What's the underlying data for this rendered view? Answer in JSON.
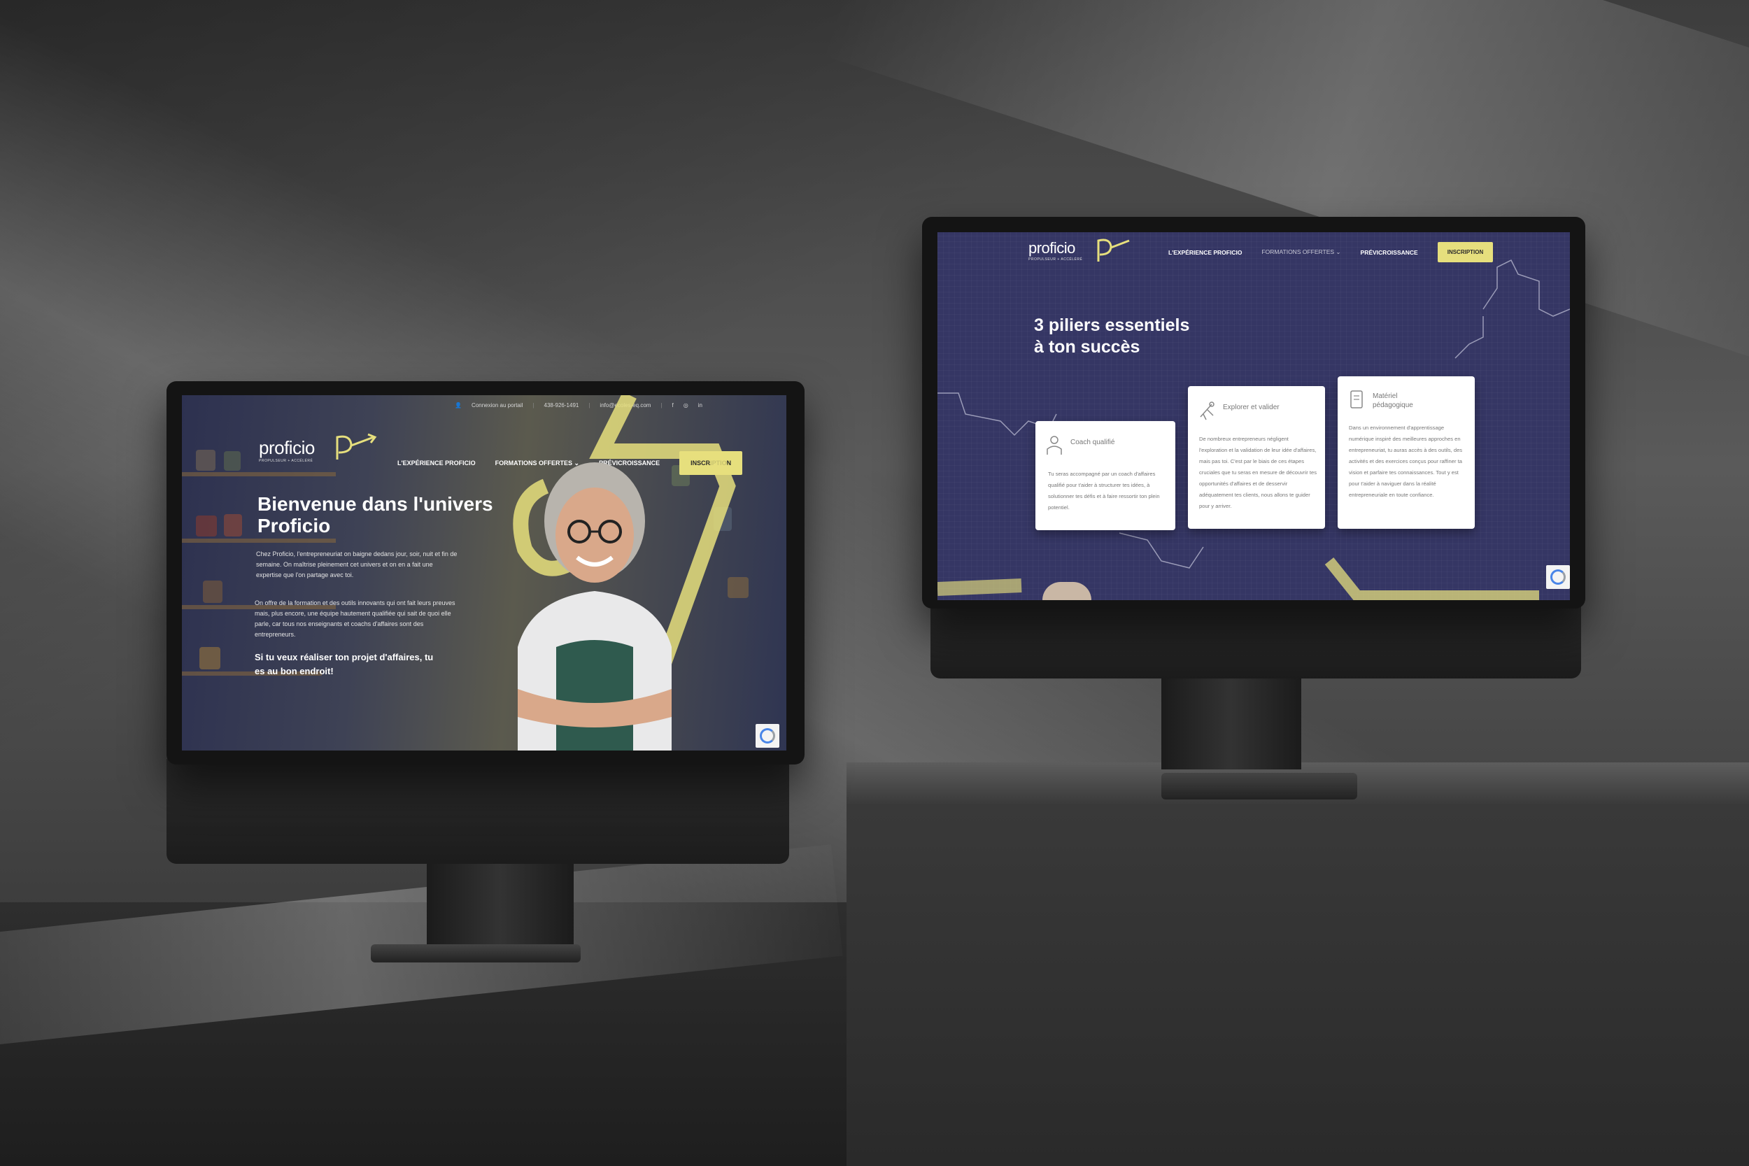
{
  "left_site": {
    "topbar": {
      "portal": "Connexion au portail",
      "phone": "438-926-1491",
      "email": "info@ecoles-eq.com",
      "social": [
        "f",
        "◎",
        "in"
      ]
    },
    "logo": {
      "word": "proficio",
      "sub": "PROPULSEUR + ACCÉLÉRÉ"
    },
    "nav": {
      "items": [
        "L'EXPÉRIENCE PROFICIO",
        "FORMATIONS OFFERTES",
        "PRÉVICROISSANCE"
      ],
      "cta": "INSCRIPTION",
      "dropdown_icon": "chevron-down-icon"
    },
    "hero": {
      "title": "Bienvenue dans l'univers Proficio",
      "p1": "Chez Proficio, l'entrepreneuriat on baigne dedans jour, soir, nuit et fin de semaine. On maîtrise pleinement cet univers et on en a fait une expertise que l'on partage avec toi.",
      "p2": "On offre de la formation et des outils innovants qui ont fait leurs preuves mais, plus encore, une équipe hautement qualifiée qui sait de quoi elle parle, car tous nos enseignants et coachs d'affaires sont des entrepreneurs.",
      "cta": "Si tu veux réaliser ton projet d'affaires, tu es au bon endroit!"
    }
  },
  "right_site": {
    "logo": {
      "word": "proficio",
      "sub": "PROPULSEUR + ACCÉLÉRÉ"
    },
    "nav": {
      "items": [
        "L'EXPÉRIENCE PROFICIO",
        "FORMATIONS OFFERTES",
        "PRÉVICROISSANCE"
      ],
      "cta": "INSCRIPTION"
    },
    "section_title_l1": "3 piliers essentiels",
    "section_title_l2": "à ton succès",
    "cards": [
      {
        "title": "Coach qualifié",
        "icon": "person-icon",
        "text": "Tu seras accompagné par un coach d'affaires qualifié pour t'aider à structurer tes idées, à solutionner tes défis et à faire ressortir ton plein potentiel."
      },
      {
        "title": "Explorer et valider",
        "icon": "telescope-icon",
        "text": "De nombreux entrepreneurs négligent l'exploration et la validation de leur idée d'affaires, mais pas toi. C'est par le biais de ces étapes cruciales que tu seras en mesure de découvrir tes opportunités d'affaires et de desservir adéquatement tes clients, nous allons te guider pour y arriver."
      },
      {
        "title": "Matériel pédagogique",
        "icon": "tablet-icon",
        "text": "Dans un environnement d'apprentissage numérique inspiré des meilleures approches en entrepreneuriat, tu auras accès à des outils, des activités et des exercices conçus pour raffiner ta vision et parfaire tes connaissances. Tout y est pour t'aider à naviguer dans la réalité entrepreneuriale en toute confiance."
      }
    ]
  },
  "colors": {
    "accent_yellow": "#e6df7d",
    "navy": "#353664",
    "bezel": "#141414"
  }
}
